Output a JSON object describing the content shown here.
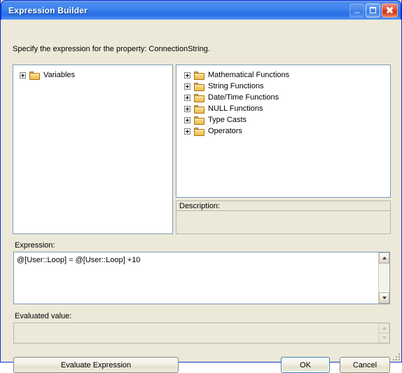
{
  "window": {
    "title": "Expression Builder",
    "buttons": {
      "minimize": "minimize",
      "maximize": "maximize",
      "close": "close"
    }
  },
  "instruction": "Specify the expression for the property: ConnectionString.",
  "tree_left": {
    "nodes": [
      {
        "label": "Variables",
        "icon": "folder-icon",
        "expander": "plus-icon"
      }
    ]
  },
  "tree_right": {
    "nodes": [
      {
        "label": "Mathematical Functions",
        "icon": "folder-icon",
        "expander": "plus-icon"
      },
      {
        "label": "String Functions",
        "icon": "folder-icon",
        "expander": "plus-icon"
      },
      {
        "label": "Date/Time Functions",
        "icon": "folder-icon",
        "expander": "plus-icon"
      },
      {
        "label": "NULL Functions",
        "icon": "folder-icon",
        "expander": "plus-icon"
      },
      {
        "label": "Type Casts",
        "icon": "folder-icon",
        "expander": "plus-icon"
      },
      {
        "label": "Operators",
        "icon": "folder-icon",
        "expander": "plus-icon"
      }
    ]
  },
  "description": {
    "label": "Description:",
    "value": ""
  },
  "expression": {
    "label": "Expression:",
    "value": "@[User::Loop] = @[User::Loop] +10"
  },
  "evaluated_value": {
    "label": "Evaluated value:",
    "value": ""
  },
  "actions": {
    "evaluate": "Evaluate Expression",
    "ok": "OK",
    "cancel": "Cancel"
  },
  "colors": {
    "titlebar_blue": "#2f76e8",
    "dialog_face": "#ece9d8",
    "border_blue": "#0831d9",
    "close_red": "#cf3418",
    "default_button_border": "#3c7fb1",
    "folder_yellow": "#eebb4d"
  }
}
